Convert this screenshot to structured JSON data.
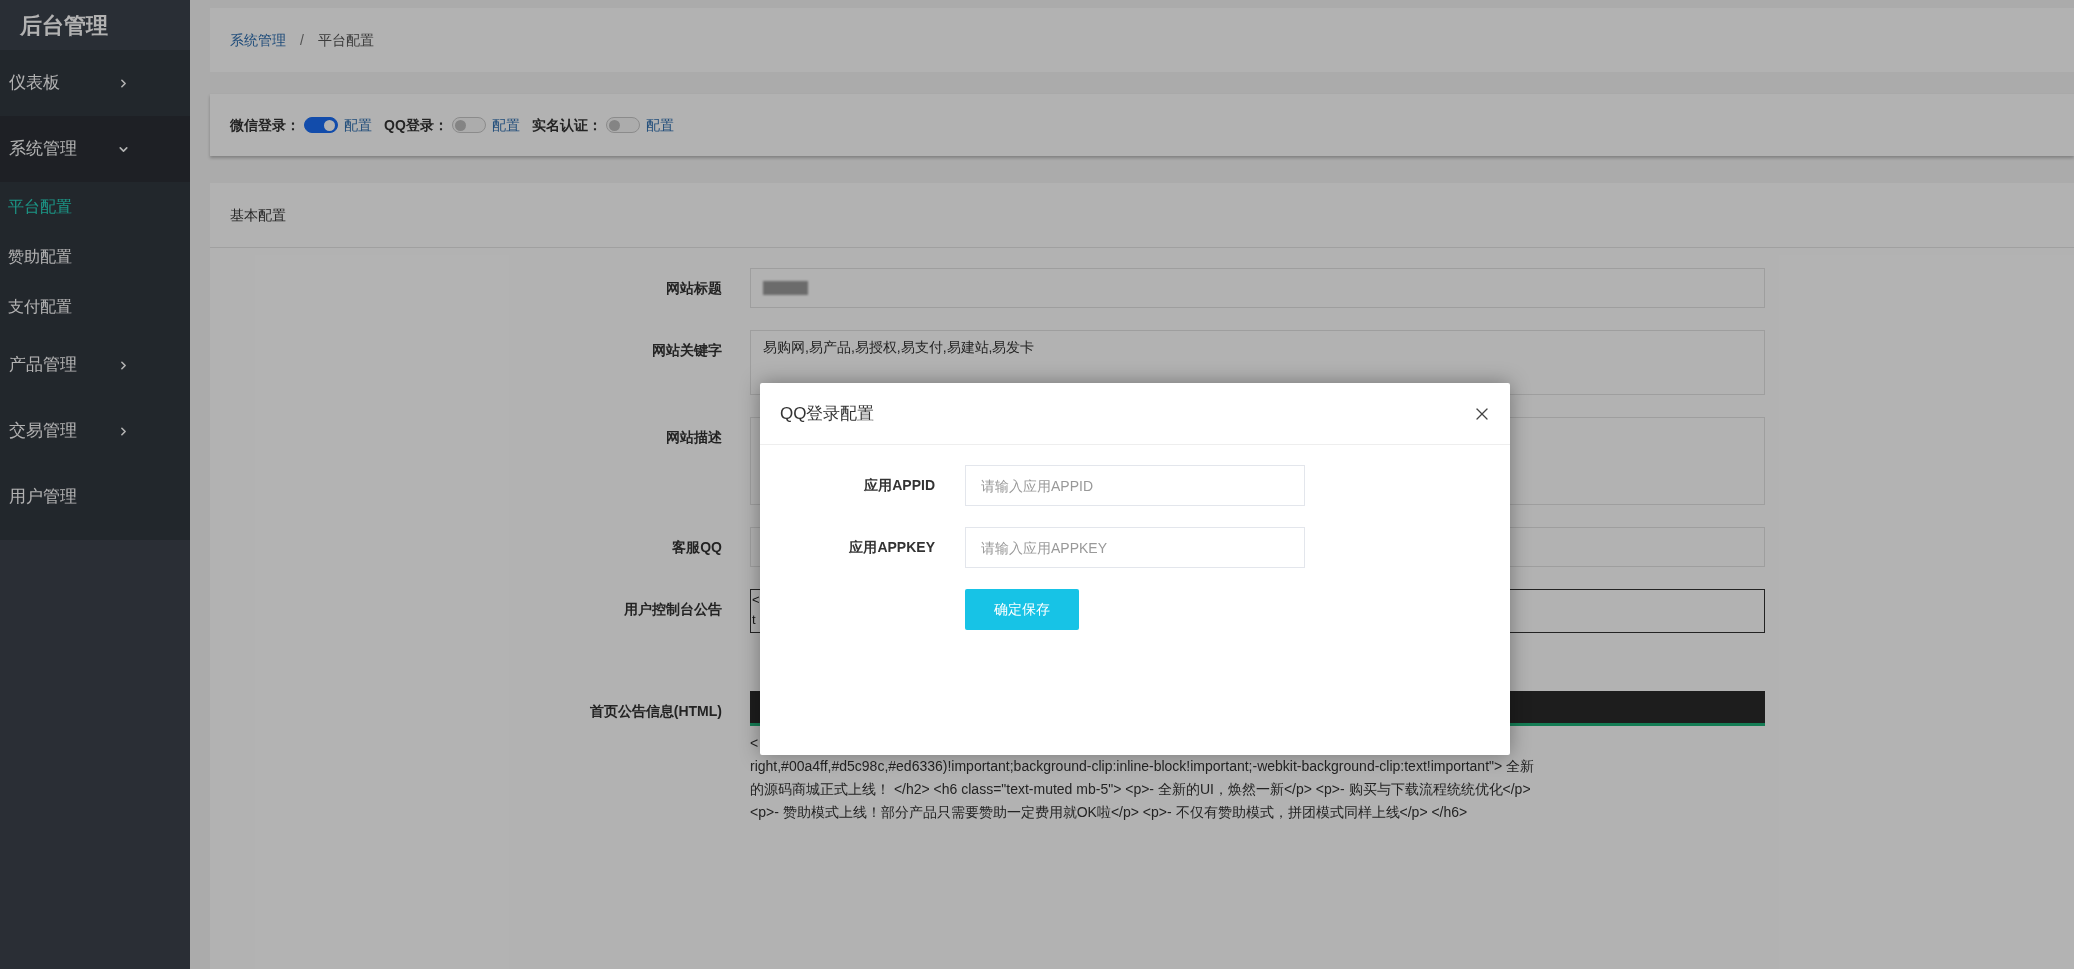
{
  "sidebar": {
    "title": "后台管理",
    "items": [
      {
        "label": "仪表板",
        "expanded": false
      },
      {
        "label": "系统管理",
        "expanded": true,
        "children": [
          {
            "label": "平台配置",
            "selected": true
          },
          {
            "label": "赞助配置",
            "selected": false
          },
          {
            "label": "支付配置",
            "selected": false
          }
        ]
      },
      {
        "label": "产品管理",
        "expanded": false
      },
      {
        "label": "交易管理",
        "expanded": false
      },
      {
        "label": "用户管理"
      }
    ]
  },
  "breadcrumb": {
    "separator": "/",
    "items": [
      {
        "label": "系统管理",
        "kind": "link"
      },
      {
        "label": "平台配置",
        "kind": "current"
      }
    ]
  },
  "login_toggles": [
    {
      "label": "微信登录：",
      "on": true,
      "link": "配置"
    },
    {
      "label": "QQ登录：",
      "on": false,
      "link": "配置"
    },
    {
      "label": "实名认证：",
      "on": false,
      "link": "配置"
    }
  ],
  "basic_config": {
    "title": "基本配置",
    "fields": [
      {
        "label": "网站标题",
        "kind": "redacted"
      },
      {
        "label": "网站关键字",
        "kind": "textarea",
        "value": "易购网,易产品,易授权,易支付,易建站,易发卡"
      },
      {
        "label": "网站描述",
        "kind": "memo"
      },
      {
        "label": "客服QQ",
        "kind": "input"
      },
      {
        "label": "用户控制台公告",
        "kind": "notice",
        "lines": [
          "<",
          "t"
        ]
      },
      {
        "label": "首页公告信息(HTML)",
        "kind": "editor",
        "lines": [
          "<",
          "right,#00a4ff,#d5c98c,#ed6336)!important;background-clip:inline-block!important;-webkit-background-clip:text!important\"> 全新",
          "的源码商城正式上线！ </h2> <h6 class=\"text-muted mb-5\"> <p>- 全新的UI，焕然一新</p> <p>- 购买与下载流程统统优化</p>",
          "<p>- 赞助模式上线！部分产品只需要赞助一定费用就OK啦</p> <p>- 不仅有赞助模式，拼团模式同样上线</p> </h6>"
        ]
      }
    ]
  },
  "modal": {
    "title": "QQ登录配置",
    "fields": [
      {
        "label": "应用APPID",
        "placeholder": "请输入应用APPID"
      },
      {
        "label": "应用APPKEY",
        "placeholder": "请输入应用APPKEY"
      }
    ],
    "submit": "确定保存"
  }
}
